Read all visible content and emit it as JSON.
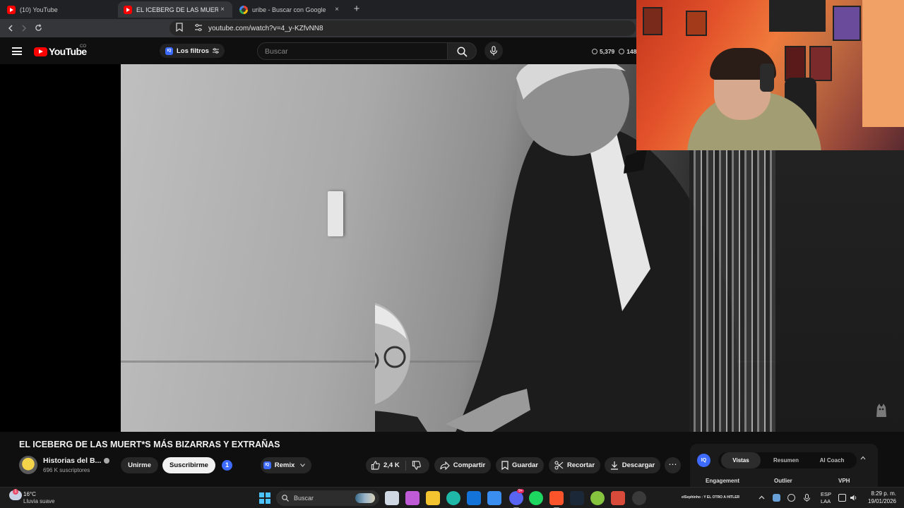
{
  "browser": {
    "tabs": [
      {
        "title": "(10) YouTube",
        "favicon": "youtube-icon",
        "active": false
      },
      {
        "title": "EL ICEBERG DE LAS MUERT*S MÁ",
        "favicon": "youtube-icon",
        "active": true
      },
      {
        "title": "uribe - Buscar con Google",
        "favicon": "google-icon",
        "active": false
      }
    ],
    "new_tab_label": "+",
    "close_label": "×",
    "url": "youtube.com/watch?v=4_y-KZfvNN8"
  },
  "youtube_header": {
    "logo_text": "YouTube",
    "country_code": "CO",
    "filter_badge": "IQ",
    "filter_label": "Los filtros",
    "search_placeholder": "Buscar",
    "stat_views": "5,379",
    "stat_other": "148"
  },
  "video": {
    "title": "EL ICEBERG DE LAS MUERT*S MÁS BIZARRAS Y EXTRAÑAS",
    "channel_name": "Historias del B...",
    "subscribers": "696 K suscriptores",
    "join_label": "Unirme",
    "subscribe_label": "Suscribirme",
    "notification_count": "1",
    "remix_badge": "IQ",
    "remix_label": "Remix",
    "likes": "2,4 K",
    "share_label": "Compartir",
    "save_label": "Guardar",
    "clip_label": "Recortar",
    "download_label": "Descargar",
    "more_label": "⋯"
  },
  "vidiq_panel": {
    "logo": "IQ",
    "tabs": [
      "Vistas",
      "Resumen",
      "AI Coach"
    ],
    "active_tab": "Vistas",
    "columns": [
      "Engagement",
      "Outlier",
      "VPH"
    ]
  },
  "taskbar": {
    "weather_temp": "16°C",
    "weather_desc": "Lluvia suave",
    "weather_badge": "1",
    "search_label": "Buscar",
    "language_top": "ESP",
    "language_bottom": "LAA",
    "time": "8:29 p. m.",
    "date": "19/01/2026",
    "overlay_caption": "elSephinho : Y EL OTRO A HITLER",
    "discord_badge": "9+",
    "apps": [
      {
        "name": "task-view-icon",
        "color": "#cfd8e3"
      },
      {
        "name": "m365-icon",
        "color": "#c05bd8"
      },
      {
        "name": "file-explorer-icon",
        "color": "#f4c430"
      },
      {
        "name": "edge-icon",
        "color": "#1fb8a8"
      },
      {
        "name": "outlook-icon",
        "color": "#1473d8"
      },
      {
        "name": "ms-store-icon",
        "color": "#3a8ef0"
      },
      {
        "name": "discord-icon",
        "color": "#5865f2"
      },
      {
        "name": "spotify-icon",
        "color": "#1ed760"
      },
      {
        "name": "brave-icon",
        "color": "#fb542b"
      },
      {
        "name": "steam-icon",
        "color": "#1b2838"
      },
      {
        "name": "android-icon",
        "color": "#86c440"
      },
      {
        "name": "media-app-icon",
        "color": "#d84a3a"
      },
      {
        "name": "obs-icon",
        "color": "#3a3a3a"
      }
    ]
  },
  "colors": {
    "youtube_red": "#ff0000",
    "vidiq_blue": "#3d6bff",
    "background": "#0f0f0f"
  }
}
